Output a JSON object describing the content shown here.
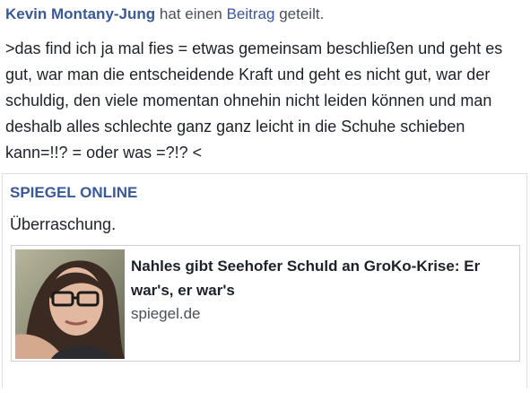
{
  "post": {
    "author": "Kevin Montany-Jung",
    "action_prefix": "hat einen",
    "action_link": "Beitrag",
    "action_suffix": "geteilt.",
    "text": ">das find ich ja mal fies = etwas gemeinsam beschließen und geht es gut, war man die entscheidende Kraft und geht es nicht gut, war der schuldig, den viele momentan ohnehin nicht leiden können und man deshalb alles schlechte ganz ganz leicht in die Schuhe schieben kann=!!? = oder was =?!? <"
  },
  "shared": {
    "source_name": "SPIEGEL ONLINE",
    "text": "Überraschung.",
    "link": {
      "title": "Nahles gibt Seehofer Schuld an GroKo-Krise: Er war's, er war's",
      "domain": "spiegel.de"
    }
  },
  "colors": {
    "link_blue": "#3b5998",
    "text": "#1d2129",
    "muted": "#4b4f56",
    "border": "#dddfe2"
  }
}
